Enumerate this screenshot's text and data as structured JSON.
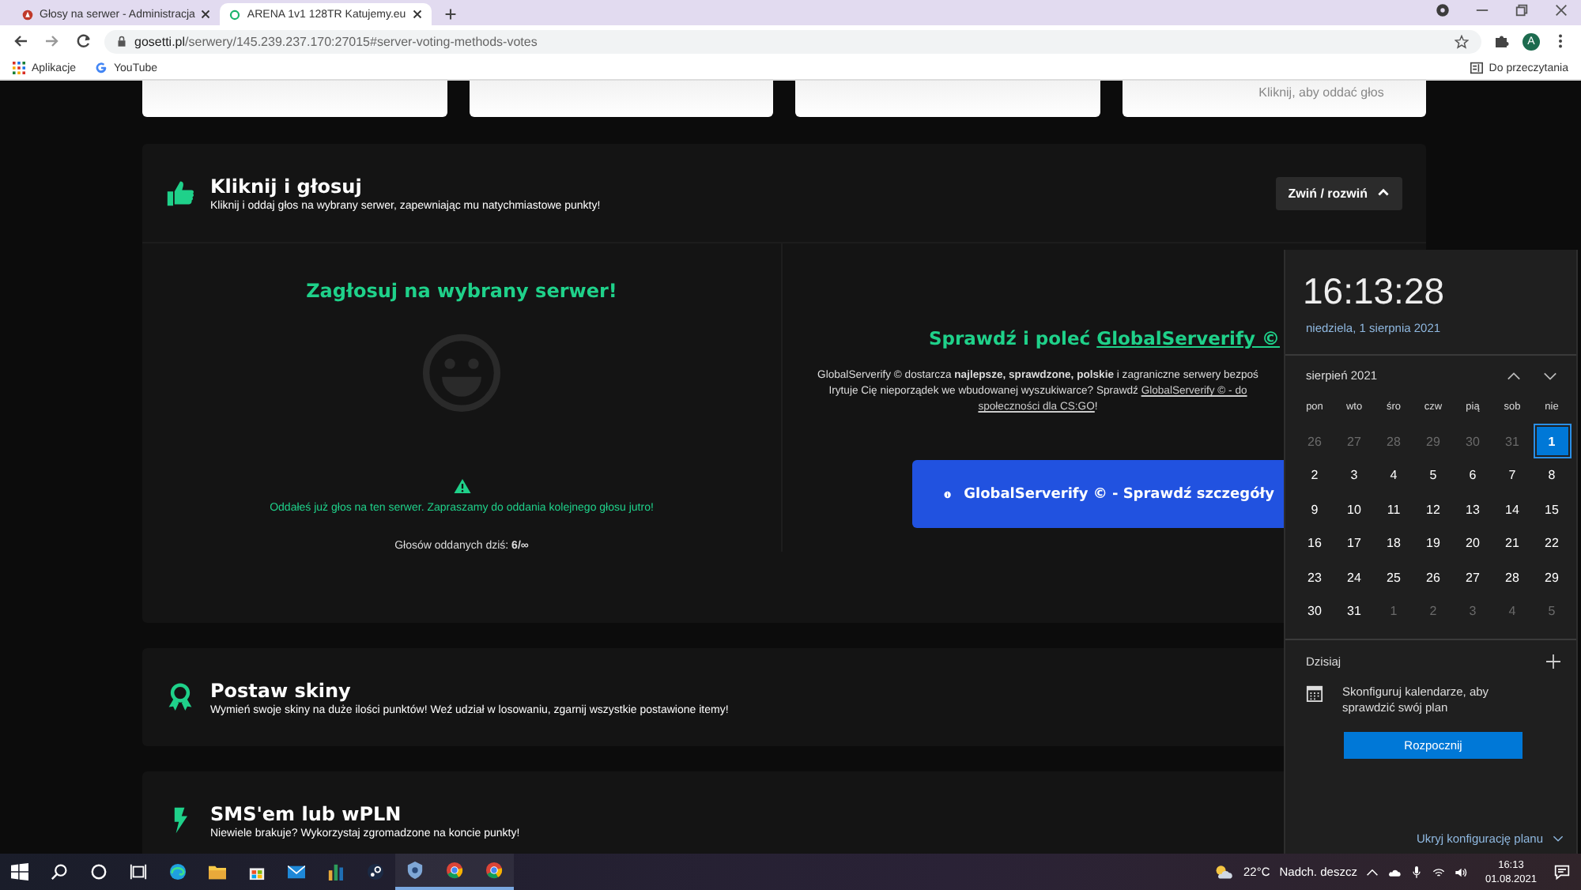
{
  "browser": {
    "tabs": [
      {
        "title": "Głosy na serwer - Administracja",
        "selected": false
      },
      {
        "title": "ARENA 1v1 128TR Katujemy.eu",
        "selected": true
      }
    ],
    "url_host": "gosetti.pl",
    "url_path": "/serwery/145.239.237.170:27015#server-voting-methods-votes",
    "profile_initial": "A",
    "bookmarks": [
      {
        "kind": "apps",
        "label": "Aplikacje"
      },
      {
        "kind": "google",
        "label": "YouTube"
      }
    ],
    "reading_list": "Do przeczytania"
  },
  "top_cards": [
    {
      "kind": "blank"
    },
    {
      "kind": "blank"
    },
    {
      "kind": "blank"
    },
    {
      "kind": "text",
      "text": "Kliknij, aby oddać głos"
    }
  ],
  "sections": [
    {
      "kind": "vote",
      "title": "Kliknij i głosuj",
      "subtitle": "Kliknij i oddaj głos na wybrany serwer, zapewniając mu natychmiastowe punkty!",
      "toggle": "Zwiń / rozwiń",
      "expanded": true
    },
    {
      "kind": "skins",
      "title": "Postaw skiny",
      "subtitle": "Wymień swoje skiny na duże ilości punktów! Weź udział w losowaniu, zgarnij wszystkie postawione itemy!"
    },
    {
      "kind": "sms",
      "title": "SMS'em lub wPLN",
      "subtitle": "Niewiele brakuje? Wykorzystaj zgromadzone na koncie punkty!"
    }
  ],
  "vote_panel": {
    "heading": "Zagłosuj na wybrany serwer!",
    "notice": "Oddałeś już głos na ten serwer. Zapraszamy do oddania kolejnego głosu jutro!",
    "votes_today": "Głosów oddanych dziś: **6/∞**"
  },
  "promo": {
    "heading": "Sprawdź i poleć",
    "heading_link": "GlobalServerify ©",
    "button": "GlobalServerify © - Sprawdź szczegóły",
    "text": [
      {
        "kind": "text",
        "text": "GlobalServerify © dostarcza **najlepsze, sprawdzone, polskie** i zagraniczne serwery bezpoś"
      },
      {
        "kind": "break"
      },
      {
        "kind": "text",
        "text": "Irytuje Cię nieporządek we wbudowanej wyszukiwarce? Sprawdź "
      },
      {
        "kind": "link",
        "text": "GlobalServerify © - do"
      },
      {
        "kind": "break"
      },
      {
        "kind": "link",
        "text": "społeczności dla CS:GO"
      },
      {
        "kind": "text",
        "text": "!"
      }
    ]
  },
  "calendar": {
    "time": "16:13:28",
    "date": "niedziela, 1 sierpnia 2021",
    "month": "sierpień 2021",
    "weekdays": [
      "pon",
      "wto",
      "śro",
      "czw",
      "pią",
      "sob",
      "nie"
    ],
    "days": [
      {
        "label": "26",
        "current": false,
        "selected": false
      },
      {
        "label": "27",
        "current": false,
        "selected": false
      },
      {
        "label": "28",
        "current": false,
        "selected": false
      },
      {
        "label": "29",
        "current": false,
        "selected": false
      },
      {
        "label": "30",
        "current": false,
        "selected": false
      },
      {
        "label": "31",
        "current": false,
        "selected": false
      },
      {
        "label": "1",
        "current": true,
        "selected": true
      },
      {
        "label": "2",
        "current": true,
        "selected": false
      },
      {
        "label": "3",
        "current": true,
        "selected": false
      },
      {
        "label": "4",
        "current": true,
        "selected": false
      },
      {
        "label": "5",
        "current": true,
        "selected": false
      },
      {
        "label": "6",
        "current": true,
        "selected": false
      },
      {
        "label": "7",
        "current": true,
        "selected": false
      },
      {
        "label": "8",
        "current": true,
        "selected": false
      },
      {
        "label": "9",
        "current": true,
        "selected": false
      },
      {
        "label": "10",
        "current": true,
        "selected": false
      },
      {
        "label": "11",
        "current": true,
        "selected": false
      },
      {
        "label": "12",
        "current": true,
        "selected": false
      },
      {
        "label": "13",
        "current": true,
        "selected": false
      },
      {
        "label": "14",
        "current": true,
        "selected": false
      },
      {
        "label": "15",
        "current": true,
        "selected": false
      },
      {
        "label": "16",
        "current": true,
        "selected": false
      },
      {
        "label": "17",
        "current": true,
        "selected": false
      },
      {
        "label": "18",
        "current": true,
        "selected": false
      },
      {
        "label": "19",
        "current": true,
        "selected": false
      },
      {
        "label": "20",
        "current": true,
        "selected": false
      },
      {
        "label": "21",
        "current": true,
        "selected": false
      },
      {
        "label": "22",
        "current": true,
        "selected": false
      },
      {
        "label": "23",
        "current": true,
        "selected": false
      },
      {
        "label": "24",
        "current": true,
        "selected": false
      },
      {
        "label": "25",
        "current": true,
        "selected": false
      },
      {
        "label": "26",
        "current": true,
        "selected": false
      },
      {
        "label": "27",
        "current": true,
        "selected": false
      },
      {
        "label": "28",
        "current": true,
        "selected": false
      },
      {
        "label": "29",
        "current": true,
        "selected": false
      },
      {
        "label": "30",
        "current": true,
        "selected": false
      },
      {
        "label": "31",
        "current": true,
        "selected": false
      },
      {
        "label": "1",
        "current": false,
        "selected": false
      },
      {
        "label": "2",
        "current": false,
        "selected": false
      },
      {
        "label": "3",
        "current": false,
        "selected": false
      },
      {
        "label": "4",
        "current": false,
        "selected": false
      },
      {
        "label": "5",
        "current": false,
        "selected": false
      }
    ],
    "agenda_title": "Dzisiaj",
    "agenda_text": "Skonfiguruj kalendarze, aby sprawdzić swój plan",
    "start_button": "Rozpocznij",
    "hide_link": "Ukryj konfigurację planu"
  },
  "taskbar": {
    "apps": [
      {
        "kind": "start",
        "running": false
      },
      {
        "kind": "search",
        "running": false
      },
      {
        "kind": "ring",
        "running": false
      },
      {
        "kind": "taskview",
        "running": false
      },
      {
        "kind": "wave",
        "running": false
      },
      {
        "kind": "folder",
        "running": false
      },
      {
        "kind": "bag",
        "running": false
      },
      {
        "kind": "mail",
        "running": false
      },
      {
        "kind": "book",
        "running": false
      },
      {
        "kind": "disc",
        "running": false
      },
      {
        "kind": "shield",
        "running": true
      },
      {
        "kind": "orb",
        "running": true
      },
      {
        "kind": "orb",
        "running": true
      }
    ],
    "temperature": "22°C",
    "weather": "Nadch. deszcz",
    "time": "16:13",
    "date": "01.08.2021"
  }
}
